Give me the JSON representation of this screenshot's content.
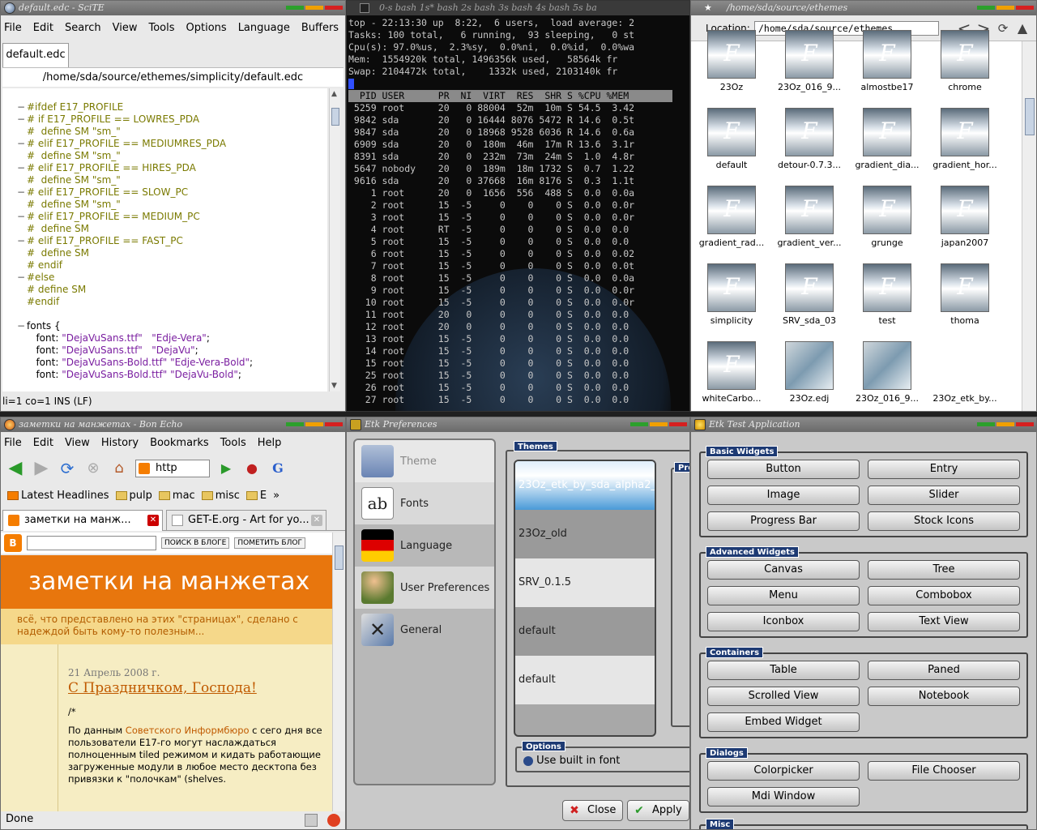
{
  "scite": {
    "title": "default.edc - SciTE",
    "menu": [
      "File",
      "Edit",
      "Search",
      "View",
      "Tools",
      "Options",
      "Language",
      "Buffers"
    ],
    "tab": "default.edc",
    "path": "/home/sda/source/ethemes/simplicity/default.edc",
    "lines": [
      {
        "t": "#ifdef E17_PROFILE",
        "c": "cmt",
        "fold": "−"
      },
      {
        "t": "# if E17_PROFILE == LOWRES_PDA",
        "c": "cmt",
        "fold": "−"
      },
      {
        "t": "#  define SM \"sm_\"",
        "c": "cmt",
        "fold": ""
      },
      {
        "t": "# elif E17_PROFILE == MEDIUMRES_PDA",
        "c": "cmt",
        "fold": "−"
      },
      {
        "t": "#  define SM \"sm_\"",
        "c": "cmt",
        "fold": ""
      },
      {
        "t": "# elif E17_PROFILE == HIRES_PDA",
        "c": "cmt",
        "fold": "−"
      },
      {
        "t": "#  define SM \"sm_\"",
        "c": "cmt",
        "fold": ""
      },
      {
        "t": "# elif E17_PROFILE == SLOW_PC",
        "c": "cmt",
        "fold": "−"
      },
      {
        "t": "#  define SM \"sm_\"",
        "c": "cmt",
        "fold": ""
      },
      {
        "t": "# elif E17_PROFILE == MEDIUM_PC",
        "c": "cmt",
        "fold": "−"
      },
      {
        "t": "#  define SM",
        "c": "cmt",
        "fold": ""
      },
      {
        "t": "# elif E17_PROFILE == FAST_PC",
        "c": "cmt",
        "fold": "−"
      },
      {
        "t": "#  define SM",
        "c": "cmt",
        "fold": ""
      },
      {
        "t": "# endif",
        "c": "cmt",
        "fold": ""
      },
      {
        "t": "#else",
        "c": "cmt",
        "fold": "−"
      },
      {
        "t": "# define SM",
        "c": "cmt",
        "fold": ""
      },
      {
        "t": "#endif",
        "c": "cmt",
        "fold": ""
      },
      {
        "t": "",
        "c": "",
        "fold": ""
      },
      {
        "t": "fonts {",
        "c": "",
        "fold": "−"
      },
      {
        "t": "   font: \"DejaVuSans.ttf\"   \"Edje-Vera\";",
        "c": "fnt",
        "fold": ""
      },
      {
        "t": "   font: \"DejaVuSans.ttf\"   \"DejaVu\";",
        "c": "fnt",
        "fold": ""
      },
      {
        "t": "   font: \"DejaVuSans-Bold.ttf\" \"Edje-Vera-Bold\";",
        "c": "fnt",
        "fold": ""
      },
      {
        "t": "   font: \"DejaVuSans-Bold.ttf\" \"DejaVu-Bold\";",
        "c": "fnt",
        "fold": ""
      }
    ],
    "status": "li=1 co=1 INS (LF)"
  },
  "terminal": {
    "tabs": "0-s bash  1s* bash  2s bash  3s bash  4s bash  5s ba",
    "summary": [
      "top - 22:13:30 up  8:22,  6 users,  load average: 2",
      "Tasks: 100 total,   6 running,  93 sleeping,   0 st",
      "Cpu(s): 97.0%us,  2.3%sy,  0.0%ni,  0.0%id,  0.0%wa",
      "Mem:  1554920k total, 1496356k used,   58564k fr",
      "Swap: 2104472k total,    1332k used, 2103140k fr"
    ],
    "header": "  PID USER      PR  NI  VIRT  RES  SHR S %CPU %MEM",
    "rows": [
      " 5259 root      20   0 88004  52m  10m S 54.5  3.42",
      " 9842 sda       20   0 16444 8076 5472 R 14.6  0.5t",
      " 9847 sda       20   0 18968 9528 6036 R 14.6  0.6a",
      " 6909 sda       20   0  180m  46m  17m R 13.6  3.1r",
      " 8391 sda       20   0  232m  73m  24m S  1.0  4.8r",
      " 5647 nobody    20   0  189m  18m 1732 S  0.7  1.22",
      " 9616 sda       20   0 37668  16m 8176 S  0.3  1.1t",
      "    1 root      20   0  1656  556  488 S  0.0  0.0a",
      "    2 root      15  -5     0    0    0 S  0.0  0.0r",
      "    3 root      15  -5     0    0    0 S  0.0  0.0r",
      "    4 root      RT  -5     0    0    0 S  0.0  0.0",
      "    5 root      15  -5     0    0    0 S  0.0  0.0",
      "    6 root      15  -5     0    0    0 S  0.0  0.02",
      "    7 root      15  -5     0    0    0 S  0.0  0.0t",
      "    8 root      15  -5     0    0    0 S  0.0  0.0a",
      "    9 root      15  -5     0    0    0 S  0.0  0.0r",
      "   10 root      15  -5     0    0    0 S  0.0  0.0r",
      "   11 root      20   0     0    0    0 S  0.0  0.0",
      "   12 root      20   0     0    0    0 S  0.0  0.0",
      "   13 root      15  -5     0    0    0 S  0.0  0.0",
      "   14 root      15  -5     0    0    0 S  0.0  0.0",
      "   15 root      15  -5     0    0    0 S  0.0  0.0",
      "   25 root      15  -5     0    0    0 S  0.0  0.0",
      "   26 root      15  -5     0    0    0 S  0.0  0.0",
      "   27 root      15  -5     0    0    0 S  0.0  0.0"
    ]
  },
  "filemanager": {
    "title": "/home/sda/source/ethemes",
    "location_label": "Location:",
    "location_value": "/home/sda/source/ethemes",
    "glyph": "F",
    "items": [
      {
        "name": "23Oz",
        "photo": false
      },
      {
        "name": "23Oz_016_9...",
        "photo": false
      },
      {
        "name": "almostbe17",
        "photo": false
      },
      {
        "name": "chrome",
        "photo": false
      },
      {
        "name": "default",
        "photo": false
      },
      {
        "name": "detour-0.7.3...",
        "photo": false
      },
      {
        "name": "gradient_dia...",
        "photo": false
      },
      {
        "name": "gradient_hor...",
        "photo": false
      },
      {
        "name": "gradient_rad...",
        "photo": false
      },
      {
        "name": "gradient_ver...",
        "photo": false
      },
      {
        "name": "grunge",
        "photo": false
      },
      {
        "name": "japan2007",
        "photo": false
      },
      {
        "name": "simplicity",
        "photo": false
      },
      {
        "name": "SRV_sda_03",
        "photo": false
      },
      {
        "name": "test",
        "photo": false
      },
      {
        "name": "thoma",
        "photo": false
      },
      {
        "name": "whiteCarbo...",
        "photo": false
      },
      {
        "name": "23Oz.edj",
        "photo": true
      },
      {
        "name": "23Oz_016_9...",
        "photo": true
      },
      {
        "name": "23Oz_etk_by...",
        "photo": "none"
      }
    ]
  },
  "firefox": {
    "title": "заметки на манжетах - Bon Echo",
    "menu": [
      "File",
      "Edit",
      "View",
      "History",
      "Bookmarks",
      "Tools",
      "Help"
    ],
    "url": "http",
    "bookmarks": [
      "Latest Headlines",
      "pulp",
      "mac",
      "misc",
      "E"
    ],
    "tab1": "заметки на манж...",
    "tab2": "GET-E.org - Art for yo...",
    "blog_btn1": "ПОИСК В БЛОГЕ",
    "blog_btn2": "ПОМЕТИТЬ БЛОГ",
    "blog_title": "заметки на манжетах",
    "tagline": "всё, что представлено на этих \"страницах\", сделано с надеждой быть кому-то полезным...",
    "date": "21 Апрель 2008 г.",
    "post_title": "С Праздничком, Господа!",
    "post_sym": "/*",
    "post_pre": "По данным ",
    "post_link": "Советского Информбюро",
    "post_rest": " с сего дня все пользователи E17-го могут наслаждаться полноценным tiled режимом и кидать работающие загруженные модули в любое место десктопа без привязки к \"полочкам\" (shelves.",
    "status": "Done"
  },
  "prefs": {
    "title": "Etk Preferences",
    "sidebar": [
      "Theme",
      "Fonts",
      "Language",
      "User Preferences",
      "General"
    ],
    "themes_label": "Themes",
    "themes": [
      "23Oz_etk_by_sda_alpha2_",
      "23Oz_old",
      "SRV_0.1.5",
      "default",
      "default"
    ],
    "preview_label": "Pre",
    "options_label": "Options",
    "use_font": "Use built in font",
    "close": "Close",
    "apply": "Apply"
  },
  "etktest": {
    "title": "Etk Test Application",
    "sections": [
      {
        "label": "Basic Widgets",
        "buttons": [
          "Button",
          "Entry",
          "Image",
          "Slider",
          "Progress Bar",
          "Stock Icons"
        ]
      },
      {
        "label": "Advanced Widgets",
        "buttons": [
          "Canvas",
          "Tree",
          "Menu",
          "Combobox",
          "Iconbox",
          "Text View"
        ]
      },
      {
        "label": "Containers",
        "buttons": [
          "Table",
          "Paned",
          "Scrolled View",
          "Notebook",
          "Embed Widget"
        ]
      },
      {
        "label": "Dialogs",
        "buttons": [
          "Colorpicker",
          "File Chooser",
          "Mdi Window"
        ]
      },
      {
        "label": "Misc",
        "buttons": []
      }
    ]
  }
}
